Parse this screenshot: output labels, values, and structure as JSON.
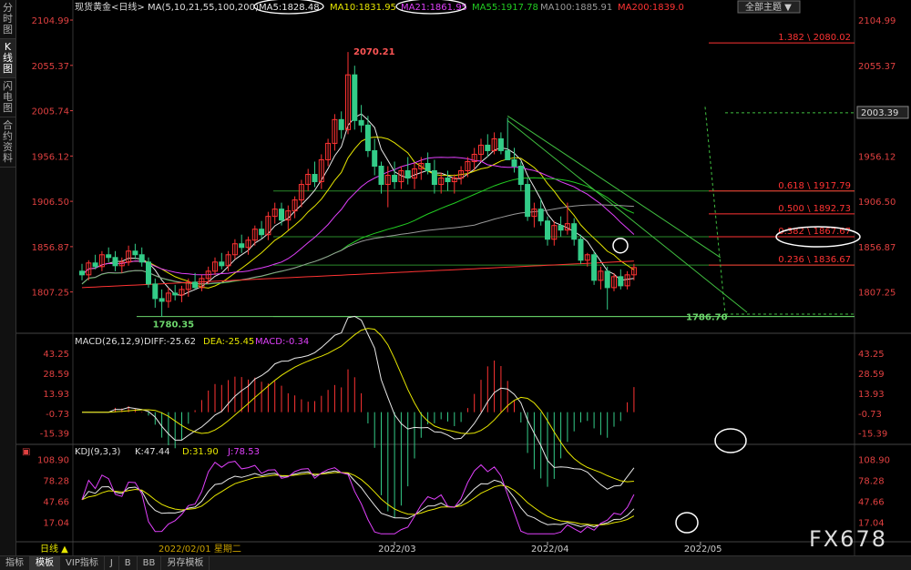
{
  "sidebar": {
    "tabs": [
      "分时图",
      "K线图",
      "闪电图",
      "合约资料"
    ],
    "active": 1
  },
  "header": {
    "instrument": "现货黄金<日线>",
    "ma_params": "MA(5,10,21,55,100,200)",
    "ma_values": [
      {
        "label": "MA5:1828.48",
        "color": "#e8e8e8",
        "circled": true
      },
      {
        "label": "MA10:1831.95",
        "color": "#e6e600",
        "circled": false
      },
      {
        "label": "MA21:1861.95",
        "color": "#e040fb",
        "circled": true
      },
      {
        "label": "MA55:1917.78",
        "color": "#22cc22",
        "circled": false
      },
      {
        "label": "MA100:1885.91",
        "color": "#999999",
        "circled": false
      },
      {
        "label": "MA200:1839.0",
        "color": "#ff3333",
        "circled": false
      }
    ],
    "theme_button": "全部主题"
  },
  "price_axis": {
    "ticks": [
      "2104.99",
      "2055.37",
      "2005.74",
      "1956.12",
      "1906.50",
      "1856.87",
      "1807.25"
    ],
    "current": "2003.39"
  },
  "annotations": {
    "high": "2070.21",
    "low_left": "1780.35",
    "low_right": "1786.70"
  },
  "fibonacci": [
    "1.382 \\ 2080.02",
    "0.618 \\ 1917.79",
    "0.500 \\ 1892.73",
    "0.382 \\ 1867.67",
    "0.236 \\ 1836.67"
  ],
  "macd": {
    "title": "MACD(26,12,9)",
    "diff": "DIFF:-25.62",
    "dea": "DEA:-25.45",
    "macd": "MACD:-0.34",
    "ticks": [
      "43.25",
      "28.59",
      "13.93",
      "-0.73",
      "-15.39"
    ]
  },
  "kdj": {
    "title": "KDJ(9,3,3)",
    "k": "K:47.44",
    "d": "D:31.90",
    "j": "J:78.53",
    "ticks": [
      "108.90",
      "78.28",
      "47.66",
      "17.04"
    ]
  },
  "x_axis": {
    "period": "日线 ▲",
    "cursor_date": "2022/02/01 星期二",
    "labels": [
      "2022/03",
      "2022/04",
      "2022/05"
    ]
  },
  "bottom_tabs": [
    "指标",
    "模板",
    "VIP指标",
    "J",
    "B",
    "BB",
    "另存模板"
  ],
  "watermark": "FX678",
  "colors": {
    "up": "#ff3333",
    "down": "#33cc88",
    "fib": "#ff3333",
    "ma5": "#e8e8e8",
    "ma10": "#e6e600",
    "ma21": "#e040fb",
    "ma55": "#22cc22",
    "ma100": "#999999",
    "ma200": "#ff3333"
  },
  "chart_data": {
    "type": "candlestick",
    "ylim": [
      1770,
      2115
    ],
    "candles": [
      [
        1830,
        1838,
        1820,
        1826
      ],
      [
        1826,
        1842,
        1820,
        1839
      ],
      [
        1839,
        1848,
        1832,
        1835
      ],
      [
        1835,
        1852,
        1830,
        1848
      ],
      [
        1848,
        1856,
        1840,
        1845
      ],
      [
        1845,
        1852,
        1830,
        1836
      ],
      [
        1836,
        1845,
        1828,
        1840
      ],
      [
        1840,
        1858,
        1836,
        1852
      ],
      [
        1852,
        1860,
        1843,
        1848
      ],
      [
        1848,
        1856,
        1835,
        1840
      ],
      [
        1840,
        1845,
        1812,
        1816
      ],
      [
        1816,
        1822,
        1790,
        1800
      ],
      [
        1800,
        1810,
        1780,
        1797
      ],
      [
        1797,
        1812,
        1790,
        1806
      ],
      [
        1806,
        1815,
        1798,
        1804
      ],
      [
        1804,
        1814,
        1796,
        1810
      ],
      [
        1810,
        1822,
        1802,
        1818
      ],
      [
        1818,
        1828,
        1810,
        1812
      ],
      [
        1812,
        1826,
        1808,
        1822
      ],
      [
        1822,
        1835,
        1816,
        1830
      ],
      [
        1830,
        1845,
        1826,
        1840
      ],
      [
        1840,
        1850,
        1832,
        1836
      ],
      [
        1836,
        1852,
        1830,
        1848
      ],
      [
        1848,
        1865,
        1843,
        1860
      ],
      [
        1860,
        1870,
        1850,
        1856
      ],
      [
        1856,
        1868,
        1848,
        1864
      ],
      [
        1864,
        1880,
        1858,
        1876
      ],
      [
        1876,
        1885,
        1866,
        1870
      ],
      [
        1870,
        1895,
        1864,
        1890
      ],
      [
        1890,
        1905,
        1882,
        1898
      ],
      [
        1898,
        1905,
        1880,
        1886
      ],
      [
        1886,
        1902,
        1875,
        1896
      ],
      [
        1896,
        1912,
        1888,
        1908
      ],
      [
        1908,
        1930,
        1900,
        1925
      ],
      [
        1925,
        1942,
        1918,
        1936
      ],
      [
        1936,
        1950,
        1922,
        1928
      ],
      [
        1928,
        1958,
        1920,
        1952
      ],
      [
        1952,
        1975,
        1945,
        1970
      ],
      [
        1970,
        2002,
        1962,
        1996
      ],
      [
        1996,
        2005,
        1975,
        1985
      ],
      [
        1985,
        2070,
        1980,
        2045
      ],
      [
        2045,
        2055,
        1985,
        1995
      ],
      [
        1995,
        2012,
        1982,
        1990
      ],
      [
        1990,
        2000,
        1955,
        1962
      ],
      [
        1962,
        1975,
        1935,
        1945
      ],
      [
        1945,
        1950,
        1915,
        1925
      ],
      [
        1925,
        1945,
        1900,
        1935
      ],
      [
        1935,
        1950,
        1920,
        1928
      ],
      [
        1928,
        1945,
        1920,
        1940
      ],
      [
        1940,
        1955,
        1925,
        1932
      ],
      [
        1932,
        1948,
        1920,
        1942
      ],
      [
        1942,
        1955,
        1930,
        1948
      ],
      [
        1948,
        1960,
        1936,
        1940
      ],
      [
        1940,
        1952,
        1915,
        1925
      ],
      [
        1925,
        1938,
        1915,
        1932
      ],
      [
        1932,
        1940,
        1918,
        1928
      ],
      [
        1928,
        1936,
        1915,
        1932
      ],
      [
        1932,
        1945,
        1925,
        1940
      ],
      [
        1940,
        1955,
        1933,
        1950
      ],
      [
        1950,
        1965,
        1940,
        1958
      ],
      [
        1958,
        1975,
        1950,
        1968
      ],
      [
        1968,
        1980,
        1955,
        1962
      ],
      [
        1962,
        1982,
        1958,
        1975
      ],
      [
        1975,
        1982,
        1958,
        1962
      ],
      [
        1962,
        1998,
        1955,
        1952
      ],
      [
        1952,
        1965,
        1938,
        1945
      ],
      [
        1945,
        1950,
        1918,
        1925
      ],
      [
        1925,
        1932,
        1885,
        1890
      ],
      [
        1890,
        1905,
        1878,
        1898
      ],
      [
        1898,
        1910,
        1880,
        1885
      ],
      [
        1885,
        1890,
        1858,
        1865
      ],
      [
        1865,
        1885,
        1858,
        1880
      ],
      [
        1880,
        1890,
        1868,
        1875
      ],
      [
        1875,
        1905,
        1870,
        1882
      ],
      [
        1882,
        1888,
        1858,
        1865
      ],
      [
        1865,
        1870,
        1838,
        1842
      ],
      [
        1842,
        1850,
        1835,
        1848
      ],
      [
        1848,
        1852,
        1815,
        1820
      ],
      [
        1820,
        1835,
        1810,
        1830
      ],
      [
        1830,
        1835,
        1788,
        1812
      ],
      [
        1812,
        1828,
        1808,
        1824
      ],
      [
        1824,
        1832,
        1810,
        1814
      ],
      [
        1814,
        1830,
        1810,
        1826
      ],
      [
        1826,
        1838,
        1820,
        1834
      ]
    ],
    "x_labels": [
      {
        "label": "2022/03",
        "index": 24
      },
      {
        "label": "2022/04",
        "index": 47
      },
      {
        "label": "2022/05",
        "index": 70
      }
    ],
    "fib_levels": [
      2080.02,
      1917.79,
      1892.73,
      1867.67,
      1836.67
    ],
    "macd_range": [
      -25,
      50
    ],
    "kdj_range": [
      -5,
      115
    ]
  }
}
